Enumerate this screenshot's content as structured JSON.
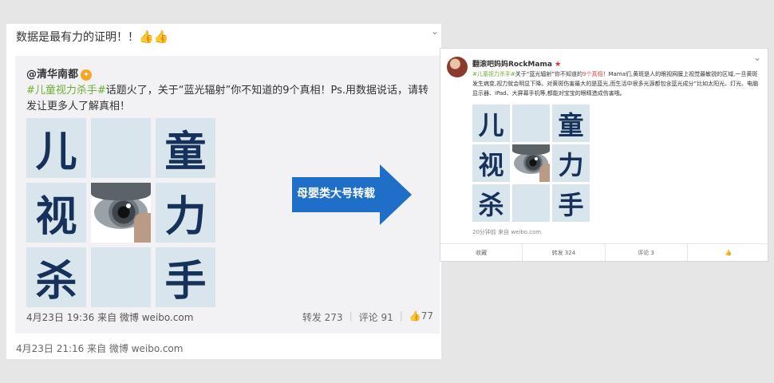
{
  "left": {
    "comment": "数据是最有力的证明！！",
    "thumbs": "👍👍",
    "repost": {
      "username": "@清华南都",
      "hashtag": "#儿童视力杀手#",
      "body": "话题火了，关于“蓝光辐射”你不知道的9个真相！Ps.用数据说话，请转发让更多人了解真相！",
      "grid": [
        "儿",
        "",
        "童",
        "视",
        "",
        "力",
        "杀",
        "",
        "手"
      ],
      "time_source": "4月23日 19:36 来自 微博 weibo.com",
      "repost_count": "转发 273",
      "comment_count": "评论 91",
      "like_count": "77"
    },
    "footer_time": "4月23日 21:16 来自 微博 weibo.com"
  },
  "arrow": {
    "label": "母婴类大号转载",
    "color": "#1f6fc9"
  },
  "right": {
    "username": "翻滚吧妈妈RockMama",
    "badge": "★",
    "hashtag": "#儿童视力杀手#",
    "body_before": "关于“蓝光辐射”你不知道的",
    "body_red": "9个真相",
    "body_after": "！Mama们,黄斑是人的眼视网膜上视觉最敏锐的区域,一旦黄斑发生病变,视力就会明显下降。对黄斑伤害最大的是蓝光,而生活中很多光源都包含蓝光成分”比如太阳光、灯光、电脑显示器、iPad、大屏幕手机等,都能对宝宝的眼睛造成伤害哦。",
    "grid": [
      "儿",
      "",
      "童",
      "视",
      "",
      "力",
      "杀",
      "",
      "手"
    ],
    "meta": "20分钟前 来自 weibo.com",
    "actions": [
      "收藏",
      "转发 324",
      "评论 3",
      "👍"
    ]
  }
}
